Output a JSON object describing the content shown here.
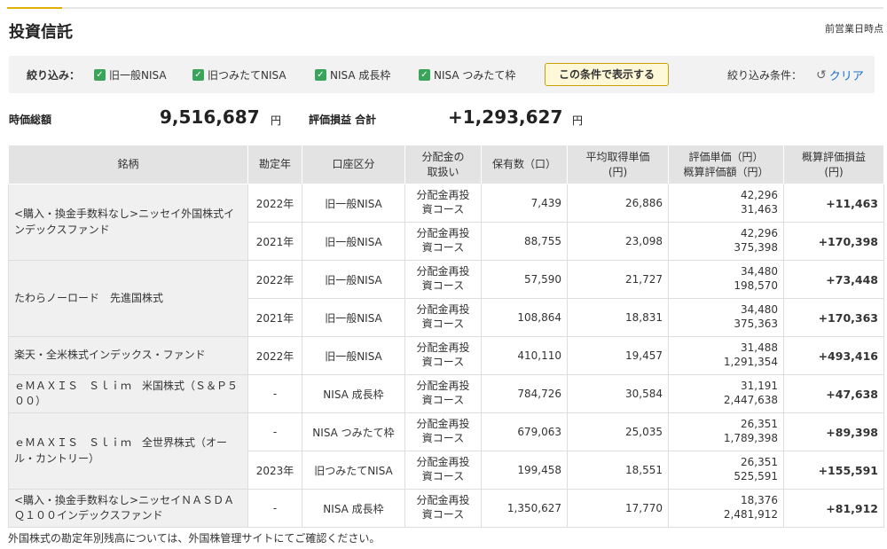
{
  "page": {
    "title": "投資信託",
    "as_of": "前営業日時点"
  },
  "filter": {
    "label": "絞り込み：",
    "options": [
      {
        "label": "旧一般NISA",
        "checked": true
      },
      {
        "label": "旧つみたてNISA",
        "checked": true
      },
      {
        "label": "NISA 成長枠",
        "checked": true
      },
      {
        "label": "NISA つみたて枠",
        "checked": true
      }
    ],
    "apply_label": "この条件で表示する",
    "conditions_label": "絞り込み条件：",
    "clear_label": "クリア"
  },
  "summary": {
    "market_value_label": "時価総額",
    "market_value": "9,516,687",
    "market_value_unit": "円",
    "pl_label": "評価損益 合計",
    "pl_value": "+1,293,627",
    "pl_unit": "円"
  },
  "table": {
    "headers": {
      "name": "銘柄",
      "year": "勘定年",
      "account": "口座区分",
      "dist_1": "分配金の",
      "dist_2": "取扱い",
      "qty": "保有数（口）",
      "avg_1": "平均取得単価",
      "avg_2": "(円)",
      "val_1": "評価単価（円）",
      "val_2": "概算評価額（円）",
      "gain_1": "概算評価損益",
      "gain_2": "(円)"
    },
    "groups": [
      {
        "name": "<購入・換金手数料なし>ニッセイ外国株式インデックスファンド",
        "rows": [
          {
            "year": "2022年",
            "account": "旧一般NISA",
            "dist_1": "分配金再投",
            "dist_2": "資コース",
            "qty": "7,439",
            "avg": "26,886",
            "unit_price": "42,296",
            "value": "31,463",
            "gain": "+11,463"
          },
          {
            "year": "2021年",
            "account": "旧一般NISA",
            "dist_1": "分配金再投",
            "dist_2": "資コース",
            "qty": "88,755",
            "avg": "23,098",
            "unit_price": "42,296",
            "value": "375,398",
            "gain": "+170,398"
          }
        ]
      },
      {
        "name": "たわらノーロード　先進国株式",
        "rows": [
          {
            "year": "2022年",
            "account": "旧一般NISA",
            "dist_1": "分配金再投",
            "dist_2": "資コース",
            "qty": "57,590",
            "avg": "21,727",
            "unit_price": "34,480",
            "value": "198,570",
            "gain": "+73,448"
          },
          {
            "year": "2021年",
            "account": "旧一般NISA",
            "dist_1": "分配金再投",
            "dist_2": "資コース",
            "qty": "108,864",
            "avg": "18,831",
            "unit_price": "34,480",
            "value": "375,363",
            "gain": "+170,363"
          }
        ]
      },
      {
        "name": "楽天・全米株式インデックス・ファンド",
        "rows": [
          {
            "year": "2022年",
            "account": "旧一般NISA",
            "dist_1": "分配金再投",
            "dist_2": "資コース",
            "qty": "410,110",
            "avg": "19,457",
            "unit_price": "31,488",
            "value": "1,291,354",
            "gain": "+493,416"
          }
        ]
      },
      {
        "name": "ｅＭＡＸＩＳ　Ｓｌｉｍ　米国株式（Ｓ＆Ｐ５００）",
        "rows": [
          {
            "year": "-",
            "account": "NISA 成長枠",
            "dist_1": "分配金再投",
            "dist_2": "資コース",
            "qty": "784,726",
            "avg": "30,584",
            "unit_price": "31,191",
            "value": "2,447,638",
            "gain": "+47,638"
          }
        ]
      },
      {
        "name": "ｅＭＡＸＩＳ　Ｓｌｉｍ　全世界株式（オール・カントリー）",
        "rows": [
          {
            "year": "-",
            "account": "NISA つみたて枠",
            "dist_1": "分配金再投",
            "dist_2": "資コース",
            "qty": "679,063",
            "avg": "25,035",
            "unit_price": "26,351",
            "value": "1,789,398",
            "gain": "+89,398"
          },
          {
            "year": "2023年",
            "account": "旧つみたてNISA",
            "dist_1": "分配金再投",
            "dist_2": "資コース",
            "qty": "199,458",
            "avg": "18,551",
            "unit_price": "26,351",
            "value": "525,591",
            "gain": "+155,591"
          }
        ]
      },
      {
        "name": "<購入・換金手数料なし>ニッセイＮＡＳＤＡＱ１００インデックスファンド",
        "rows": [
          {
            "year": "-",
            "account": "NISA 成長枠",
            "dist_1": "分配金再投",
            "dist_2": "資コース",
            "qty": "1,350,627",
            "avg": "17,770",
            "unit_price": "18,376",
            "value": "2,481,912",
            "gain": "+81,912"
          }
        ]
      }
    ]
  },
  "note": "外国株式の勘定年別残高については、外国株管理サイトにてご確認ください。",
  "colors": {
    "accent": "#e0b000",
    "checkbox": "#3aa55a",
    "link": "#1a6fc9",
    "header_bg": "#e3e3e3"
  }
}
